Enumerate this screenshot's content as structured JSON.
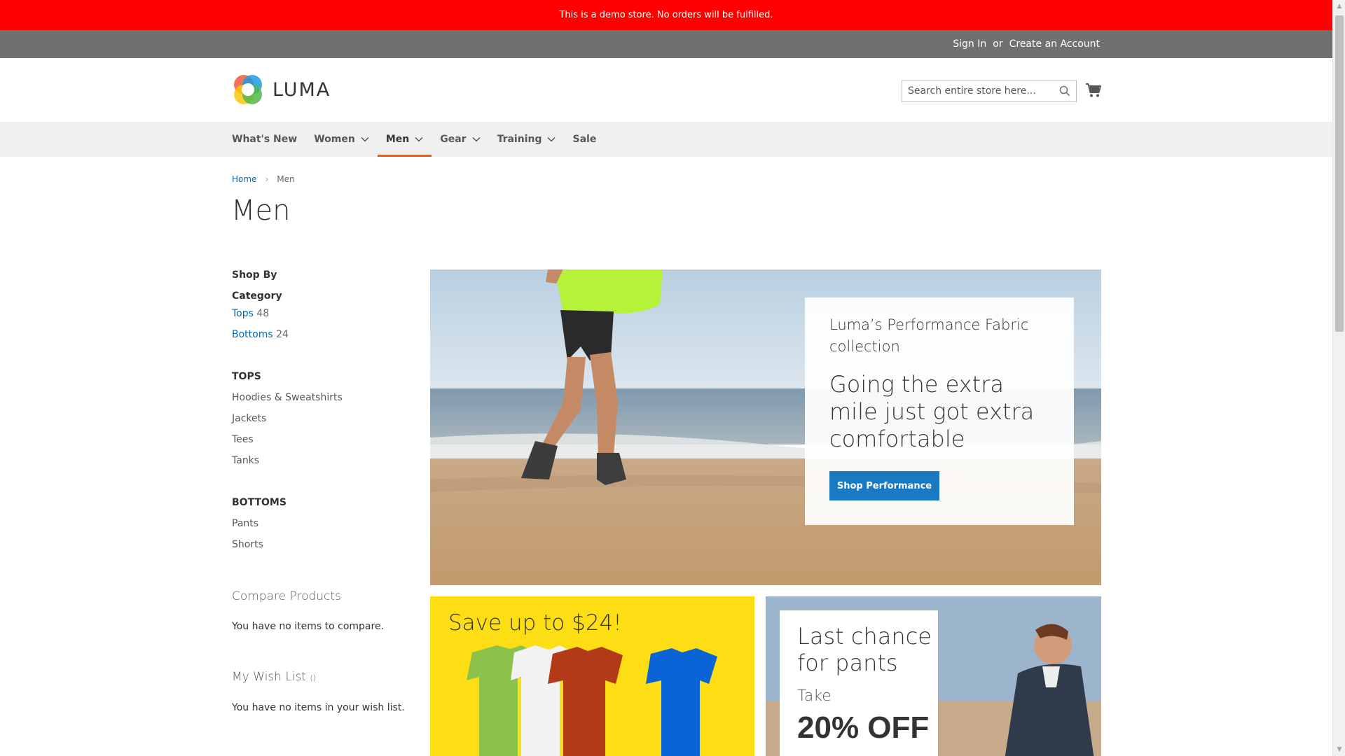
{
  "demo_notice": "This is a demo store. No orders will be fulfilled.",
  "header_links": {
    "sign_in": "Sign In",
    "or": "or",
    "create_account": "Create an Account"
  },
  "logo": {
    "text": "LUMA"
  },
  "search": {
    "placeholder": "Search entire store here..."
  },
  "nav": {
    "items": [
      {
        "label": "What's New",
        "has_dropdown": false
      },
      {
        "label": "Women",
        "has_dropdown": true
      },
      {
        "label": "Men",
        "has_dropdown": true,
        "active": true
      },
      {
        "label": "Gear",
        "has_dropdown": true
      },
      {
        "label": "Training",
        "has_dropdown": true
      },
      {
        "label": "Sale",
        "has_dropdown": false
      }
    ]
  },
  "breadcrumbs": {
    "home": "Home",
    "separator": "›",
    "current": "Men"
  },
  "page_title": "Men",
  "sidebar": {
    "shop_by": "Shop By",
    "category_title": "Category",
    "categories": [
      {
        "label": "Tops",
        "count": "48"
      },
      {
        "label": "Bottoms",
        "count": "24"
      }
    ],
    "tops_title": "TOPS",
    "tops_items": [
      "Hoodies & Sweatshirts",
      "Jackets",
      "Tees",
      "Tanks"
    ],
    "bottoms_title": "BOTTOMS",
    "bottoms_items": [
      "Pants",
      "Shorts"
    ],
    "compare_title": "Compare Products",
    "compare_empty": "You have no items to compare.",
    "wishlist_title": "My Wish List",
    "wishlist_count": "()",
    "wishlist_empty": "You have no items in your wish list."
  },
  "hero": {
    "subtitle": "Luma’s Performance Fabric collection",
    "headline": "Going the extra mile just got extra comfortable",
    "button": "Shop Performance"
  },
  "promo_yellow": {
    "title": "Save up to $24!"
  },
  "promo_blue": {
    "title": "Last chance for pants",
    "take": "Take",
    "discount": "20% OFF"
  },
  "colors": {
    "demo_bar": "#ff0000",
    "panel_header": "#6e716e",
    "link": "#006bb4",
    "primary_button": "#1979c3",
    "nav_active_underline": "#ff5501",
    "promo_yellow": "#fddd14"
  }
}
